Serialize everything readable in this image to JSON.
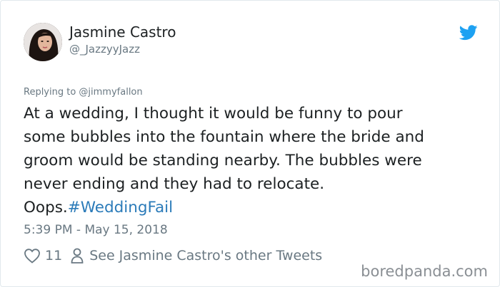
{
  "tweet": {
    "author": {
      "display_name": "Jasmine Castro",
      "handle": "@_JazzyyJazz",
      "avatar_icon": "avatar-photo"
    },
    "platform_icon": "twitter-bird-icon",
    "brand_color": "#1da1f2",
    "reply_to": "Replying to @jimmyfallon",
    "body_lines": [
      "At a wedding, I thought it would be funny to pour",
      "some bubbles into the fountain where the bride and",
      "groom would be standing nearby. The bubbles were",
      "never ending and they had to relocate."
    ],
    "last_line_text": "Oops.",
    "hashtag": "#WeddingFail",
    "hashtag_color": "#2b7bb9",
    "timestamp": "5:39 PM - May 15, 2018",
    "like_count": "11",
    "other_tweets_link": "See Jasmine Castro's other Tweets"
  },
  "watermark": "boredpanda.com"
}
